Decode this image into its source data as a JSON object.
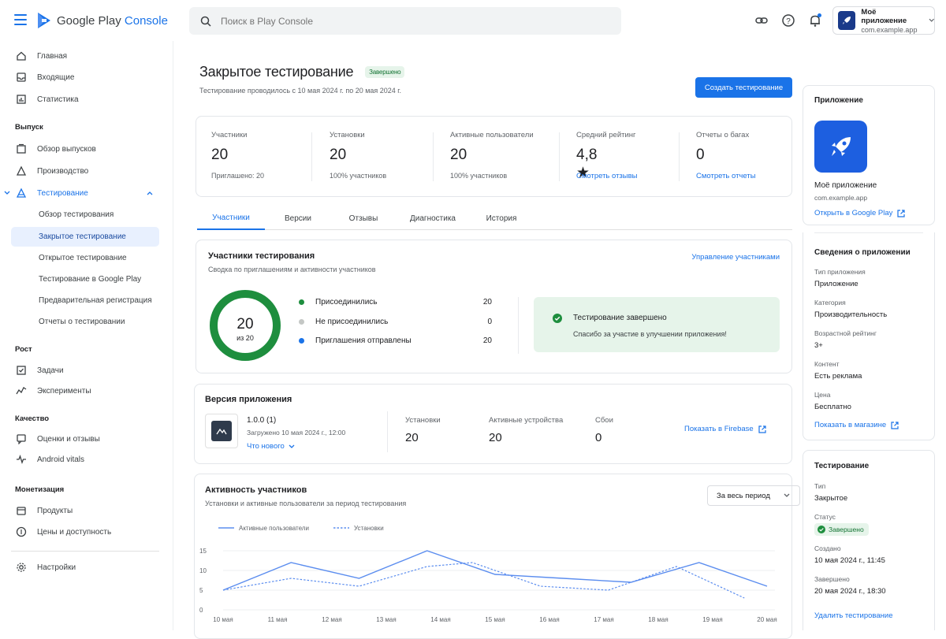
{
  "header": {
    "brand_part1": "Google Play ",
    "brand_part2": "Console",
    "search_placeholder": "Поиск в Play Console",
    "app_name": "Моё приложение",
    "app_package": "com.example.app"
  },
  "sidebar": {
    "top": [
      {
        "label": "Главная",
        "icon": "home-icon"
      },
      {
        "label": "Входящие",
        "icon": "inbox-icon"
      },
      {
        "label": "Статистика",
        "icon": "stats-icon"
      }
    ],
    "sec_release": "Выпуск",
    "release": [
      {
        "label": "Обзор выпусков",
        "icon": "releases-icon"
      },
      {
        "label": "Производство",
        "icon": "production-icon"
      },
      {
        "label": "Тестирование",
        "icon": "testing-icon"
      }
    ],
    "testing_sub": [
      "Обзор тестирования",
      "Закрытое тестирование",
      "Открытое тестирование",
      "Тестирование в Google Play",
      "Предварительная регистрация",
      "Отчеты о тестировании"
    ],
    "sec_growth": "Рост",
    "growth": [
      {
        "label": "Задачи",
        "icon": "tasks-icon"
      },
      {
        "label": "Эксперименты",
        "icon": "experiments-icon"
      }
    ],
    "sec_quality": "Качество",
    "quality": [
      {
        "label": "Оценки и отзывы",
        "icon": "reviews-icon"
      },
      {
        "label": "Android vitals",
        "icon": "vitals-icon"
      }
    ],
    "sec_monet": "Монетизация",
    "monet": [
      {
        "label": "Продукты",
        "icon": "products-icon"
      },
      {
        "label": "Цены и доступность",
        "icon": "pricing-icon"
      }
    ],
    "settings": "Настройки"
  },
  "page": {
    "title": "Закрытое тестирование",
    "status": "Завершено",
    "subtitle": "Тестирование проводилось с 10 мая 2024 г. по 20 мая 2024 г.",
    "create_button": "Создать тестирование"
  },
  "stats": [
    {
      "label": "Участники",
      "value": "20",
      "sub": "Приглашено: 20"
    },
    {
      "label": "Установки",
      "value": "20",
      "sub": "100% участников"
    },
    {
      "label": "Активные пользователи",
      "value": "20",
      "sub": "100% участников"
    },
    {
      "label": "Средний рейтинг",
      "value": "4,8 ★",
      "link": "Смотреть отзывы"
    },
    {
      "label": "Отчеты о багах",
      "value": "0",
      "link": "Смотреть отчеты"
    }
  ],
  "tabs": [
    "Участники",
    "Версии",
    "Отзывы",
    "Диагностика",
    "История"
  ],
  "participants": {
    "title": "Участники тестирования",
    "subtitle": "Сводка по приглашениям и активности участников",
    "manage_link": "Управление участниками",
    "donut_value": "20",
    "donut_sub": "из 20",
    "joined_fraction": 1.0,
    "legend": [
      {
        "label": "Присоединились",
        "count": "20",
        "color": "#1e8e3e"
      },
      {
        "label": "Не присоединились",
        "count": "0",
        "color": "#c4c7c5"
      },
      {
        "label": "Приглашения отправлены",
        "count": "20",
        "color": "#1a73e8"
      }
    ],
    "done_title": "Тестирование завершено",
    "done_text": "Спасибо за участие в улучшении приложения!"
  },
  "version": {
    "title": "Версия приложения",
    "number": "1.0.0 (1)",
    "uploaded": "Загружено 10 мая 2024 г., 12:00",
    "whats_new": "Что нового",
    "installs_label": "Установки",
    "installs_value": "20",
    "devices_label": "Активные устройства",
    "devices_value": "20",
    "crashes_label": "Сбои",
    "crashes_value": "0",
    "firebase_link": "Показать в Firebase"
  },
  "activity": {
    "title": "Активность участников",
    "subtitle": "Установки и активные пользователи за период тестирования",
    "period": "За весь период"
  },
  "chart_data": {
    "type": "line",
    "x": [
      "10 мая",
      "11 мая",
      "12 мая",
      "13 мая",
      "14 мая",
      "15 мая",
      "16 мая",
      "17 мая",
      "18 мая",
      "19 мая",
      "20 мая"
    ],
    "series": [
      {
        "name": "Активные пользователи",
        "values": [
          5,
          12,
          8,
          15,
          9,
          8,
          7,
          12,
          6
        ],
        "x_index": [
          0,
          1.5,
          3,
          4.5,
          6,
          7.5,
          9,
          10.5,
          12
        ]
      },
      {
        "name": "Установки",
        "values": [
          5,
          8,
          6,
          11,
          12,
          6,
          5,
          11,
          3
        ],
        "x_index": [
          0,
          1.5,
          3,
          4.5,
          5.5,
          7,
          8.5,
          10,
          11.5
        ]
      }
    ],
    "yticks": [
      0,
      5,
      10,
      15
    ],
    "ylim": [
      0,
      15
    ],
    "grid": true,
    "legend_position": "top-left"
  },
  "app_panel": {
    "title": "Приложение",
    "name": "Моё приложение",
    "package": "com.example.app",
    "open_link": "Открыть в Google Play"
  },
  "app_info": {
    "title": "Сведения о приложении",
    "rows": [
      {
        "label": "Тип приложения",
        "value": "Приложение"
      },
      {
        "label": "Категория",
        "value": "Производительность"
      },
      {
        "label": "Возрастной рейтинг",
        "value": "3+"
      },
      {
        "label": "Контент",
        "value": "Есть реклама"
      },
      {
        "label": "Цена",
        "value": "Бесплатно"
      }
    ],
    "store_link": "Показать в магазине"
  },
  "testing_info": {
    "title": "Тестирование",
    "type_label": "Тип",
    "type_value": "Закрытое",
    "status_label": "Статус",
    "status_value": "Завершено",
    "created_label": "Создано",
    "created_value": "10 мая 2024 г., 11:45",
    "finished_label": "Завершено",
    "finished_value": "20 мая 2024 г., 18:30",
    "delete_link": "Удалить тестирование"
  }
}
